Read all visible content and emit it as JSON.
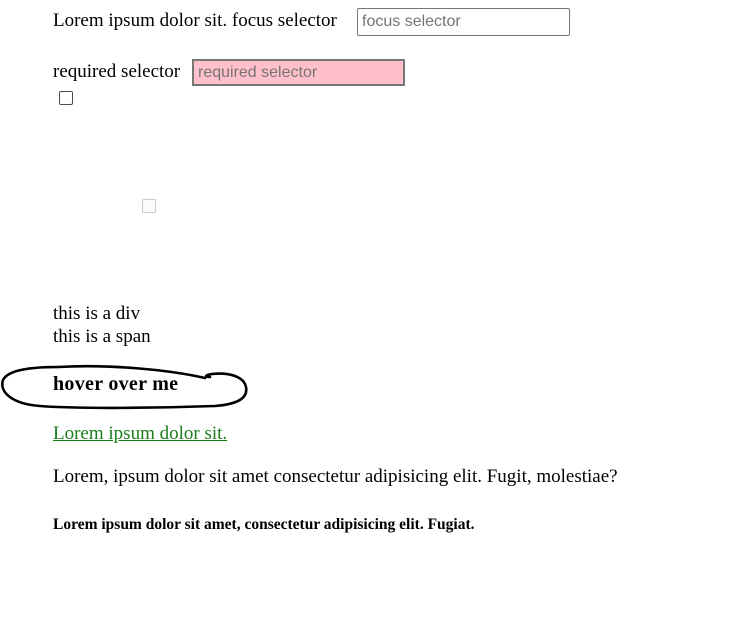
{
  "focus_row": {
    "label": "Lorem ipsum dolor sit. focus selector",
    "input_placeholder": "focus selector",
    "input_value": ""
  },
  "required_row": {
    "label": "required selector",
    "input_placeholder": "required selector",
    "input_value": "",
    "background_color": "#ffc0cb"
  },
  "checkbox_enabled": {
    "checked": false
  },
  "checkbox_disabled": {
    "checked": false,
    "disabled": true
  },
  "div_text": "this is a div",
  "span_text": "this is a span",
  "hover_text": "hover over me",
  "link_text": "Lorem ipsum dolor sit.",
  "link_color": "#1a7f1a",
  "paragraph_text": "Lorem, ipsum dolor sit amet consectetur adipisicing elit. Fugit, molestiae?",
  "bold_paragraph_text": "Lorem ipsum dolor sit amet, consectetur adipisicing elit. Fugiat."
}
